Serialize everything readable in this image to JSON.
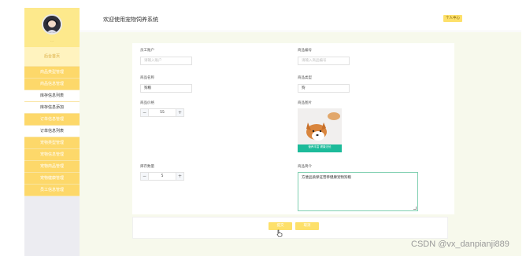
{
  "sidebar": {
    "avatar_name": "...",
    "items": [
      {
        "label": "后台首页",
        "kind": "home"
      },
      {
        "label": "商品类型管理",
        "kind": "main"
      },
      {
        "label": "商品信息管理",
        "kind": "main"
      },
      {
        "label": "库存信息列表",
        "kind": "sub"
      },
      {
        "label": "库存信息添加",
        "kind": "sub"
      },
      {
        "label": "订单信息管理",
        "kind": "main"
      },
      {
        "label": "订单信息列表",
        "kind": "sub"
      },
      {
        "label": "宠物类型管理",
        "kind": "main"
      },
      {
        "label": "宠物信息管理",
        "kind": "main"
      },
      {
        "label": "宠物商品管理",
        "kind": "main"
      },
      {
        "label": "宠物健康管理",
        "kind": "main"
      },
      {
        "label": "员工信息管理",
        "kind": "main"
      }
    ]
  },
  "header": {
    "title": "欢迎使用宠物饲养系统",
    "personal_center": "个人中心"
  },
  "form": {
    "employee_no_label": "员工账户",
    "employee_no_placeholder": "请输入账户",
    "product_no_label": "商品编号",
    "product_no_placeholder": "请输入商品编号",
    "product_name_label": "商品名称",
    "product_name_value": "狗粮",
    "product_type_label": "商品类型",
    "product_type_value": "狗",
    "price_label": "商品价格",
    "price_value": "55",
    "image_label": "商品图片",
    "image_caption": "营养丰富 健康无忧",
    "quantity_label": "库存数量",
    "quantity_value": "5",
    "description_label": "商品简介",
    "description_value": "方便品质保证营养健康宠物狗粮"
  },
  "actions": {
    "submit_label": "提交",
    "cancel_label": "取消"
  },
  "watermark": "CSDN @vx_danpianji889",
  "colors": {
    "accent": "#fdd86a",
    "menu_home_bg": "#fff3bf",
    "main_bg": "#f7f9ec",
    "textarea_border": "#7fcfb0"
  }
}
